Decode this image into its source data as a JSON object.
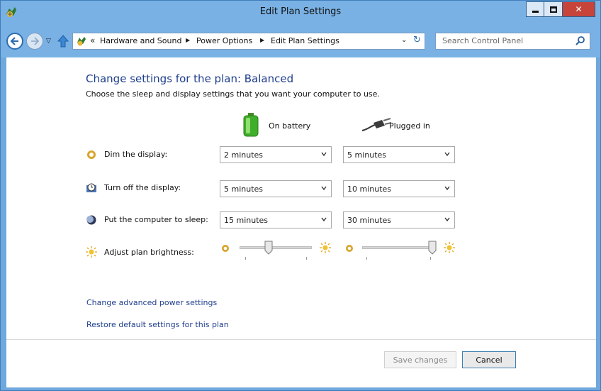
{
  "window": {
    "title": "Edit Plan Settings",
    "accent": "#79b1e4",
    "close_color": "#c7443a"
  },
  "nav": {
    "breadcrumbs": [
      "Hardware and Sound",
      "Power Options",
      "Edit Plan Settings"
    ],
    "breadcrumb_prefix": "«",
    "search_placeholder": "Search Control Panel"
  },
  "main": {
    "heading": "Change settings for the plan: Balanced",
    "subheading": "Choose the sleep and display settings that you want your computer to use.",
    "columns": {
      "battery": "On battery",
      "plugged": "Plugged in"
    },
    "rows": [
      {
        "icon": "dim-display-icon",
        "label": "Dim the display:",
        "battery": "2 minutes",
        "plugged": "5 minutes"
      },
      {
        "icon": "turn-off-display-icon",
        "label": "Turn off the display:",
        "battery": "5 minutes",
        "plugged": "10 minutes"
      },
      {
        "icon": "sleep-icon",
        "label": "Put the computer to sleep:",
        "battery": "15 minutes",
        "plugged": "30 minutes"
      }
    ],
    "brightness": {
      "label": "Adjust plan brightness:",
      "battery_level": 0.4,
      "plugged_level": 0.95
    },
    "links": {
      "advanced": "Change advanced power settings",
      "restore": "Restore default settings for this plan"
    }
  },
  "footer": {
    "save_label": "Save changes",
    "cancel_label": "Cancel"
  }
}
